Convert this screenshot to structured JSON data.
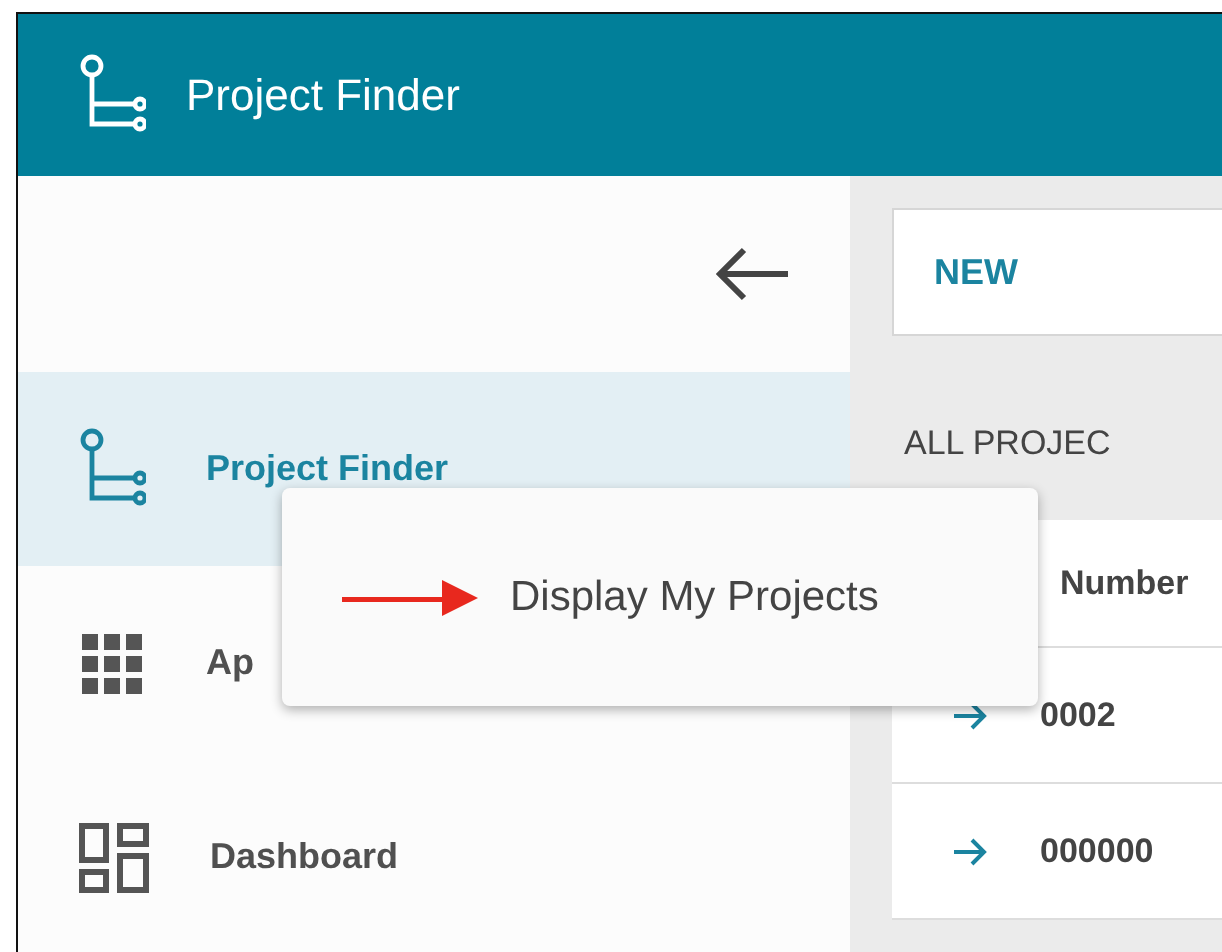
{
  "header": {
    "title": "Project Finder"
  },
  "sidebar": {
    "items": [
      {
        "label": "Project Finder",
        "kind": "tree",
        "selected": true
      },
      {
        "label": "Ap",
        "kind": "grid",
        "selected": false
      },
      {
        "label": "Dashboard",
        "kind": "dashboard",
        "selected": false
      }
    ]
  },
  "main": {
    "new_button": "NEW",
    "section_title": "ALL PROJEC",
    "table": {
      "columns": [
        "Number"
      ],
      "rows": [
        [
          "0002"
        ],
        [
          "000000"
        ]
      ]
    }
  },
  "tooltip": {
    "text": "Display My Projects"
  }
}
